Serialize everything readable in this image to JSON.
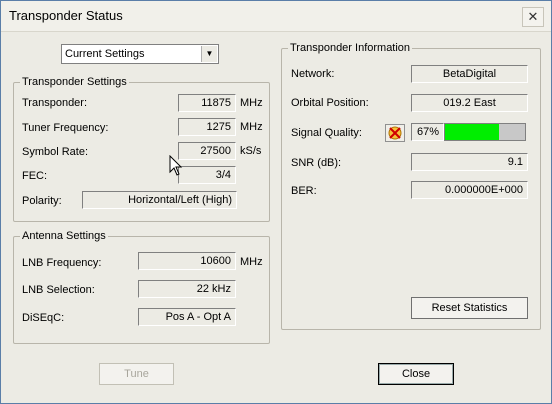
{
  "window": {
    "title": "Transponder Status",
    "close_glyph": "✕"
  },
  "mode_select": {
    "selected": "Current Settings"
  },
  "transponder_settings": {
    "title": "Transponder Settings",
    "transponder": {
      "label": "Transponder:",
      "value": "11875",
      "unit": "MHz"
    },
    "tuner_frequency": {
      "label": "Tuner Frequency:",
      "value": "1275",
      "unit": "MHz"
    },
    "symbol_rate": {
      "label": "Symbol Rate:",
      "value": "27500",
      "unit": "kS/s"
    },
    "fec": {
      "label": "FEC:",
      "value": "3/4"
    },
    "polarity": {
      "label": "Polarity:",
      "value": "Horizontal/Left (High)"
    }
  },
  "antenna_settings": {
    "title": "Antenna Settings",
    "lnb_frequency": {
      "label": "LNB Frequency:",
      "value": "10600",
      "unit": "MHz"
    },
    "lnb_selection": {
      "label": "LNB Selection:",
      "value": "22 kHz"
    },
    "diseqc": {
      "label": "DiSEqC:",
      "value": "Pos A - Opt A"
    }
  },
  "transponder_information": {
    "title": "Transponder Information",
    "network": {
      "label": "Network:",
      "value": "BetaDigital"
    },
    "orbital_position": {
      "label": "Orbital Position:",
      "value": "019.2 East"
    },
    "signal_quality": {
      "label": "Signal Quality:",
      "value": "67%",
      "level": 0.67,
      "bar_color": "#00ee00"
    },
    "snr": {
      "label": "SNR (dB):",
      "value": "9.1"
    },
    "ber": {
      "label": "BER:",
      "value": "0.000000E+000"
    },
    "reset_button": "Reset Statistics"
  },
  "buttons": {
    "tune": "Tune",
    "close": "Close"
  },
  "icons": {
    "signal_icon": "signal-quality-icon",
    "cursor": "mouse-pointer-icon"
  }
}
